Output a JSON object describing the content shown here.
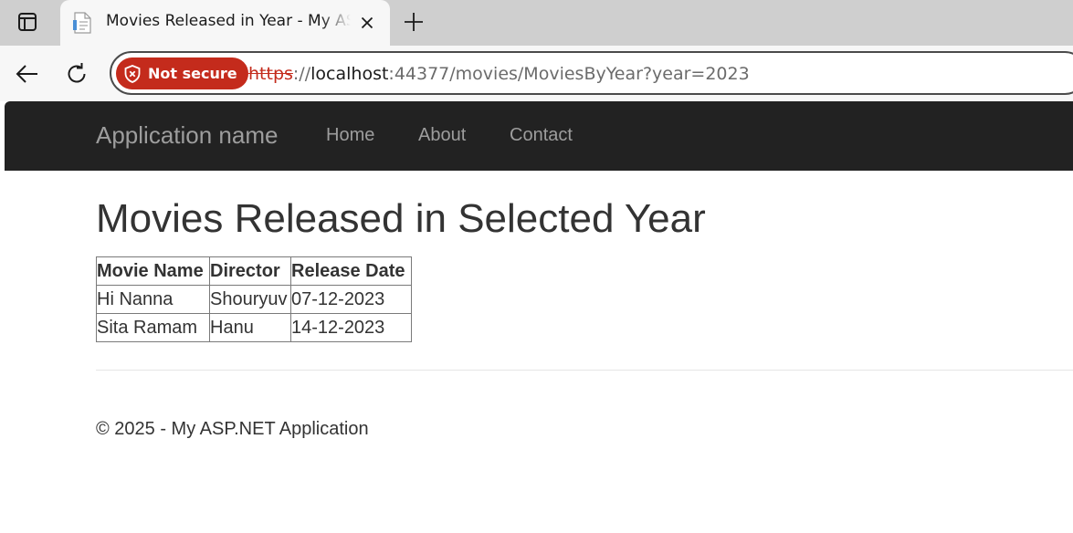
{
  "browser": {
    "tab": {
      "title": "Movies Released in Year - My ASP.NET Application",
      "favicon": "page-icon"
    },
    "address": {
      "security_label": "Not secure",
      "scheme": "https",
      "separator": "://",
      "host": "localhost",
      "rest": ":44377/movies/MoviesByYear?year=2023"
    },
    "icons": {
      "tab_actions": "tab-actions-icon",
      "close": "close-icon",
      "new_tab": "plus-icon",
      "back": "back-arrow-icon",
      "reload": "reload-icon",
      "security": "shield-warning-icon"
    },
    "colors": {
      "not_secure": "#c42b1c"
    }
  },
  "site": {
    "brand": "Application name",
    "nav": [
      "Home",
      "About",
      "Contact"
    ],
    "navbar_color": "#222222"
  },
  "main": {
    "heading": "Movies Released in Selected Year",
    "table": {
      "headers": [
        "Movie Name",
        "Director",
        "Release Date"
      ],
      "rows": [
        [
          "Hi Nanna",
          "Shouryuv",
          "07-12-2023"
        ],
        [
          "Sita Ramam",
          "Hanu",
          "14-12-2023"
        ]
      ]
    }
  },
  "footer": {
    "text": "© 2025 - My ASP.NET Application"
  }
}
